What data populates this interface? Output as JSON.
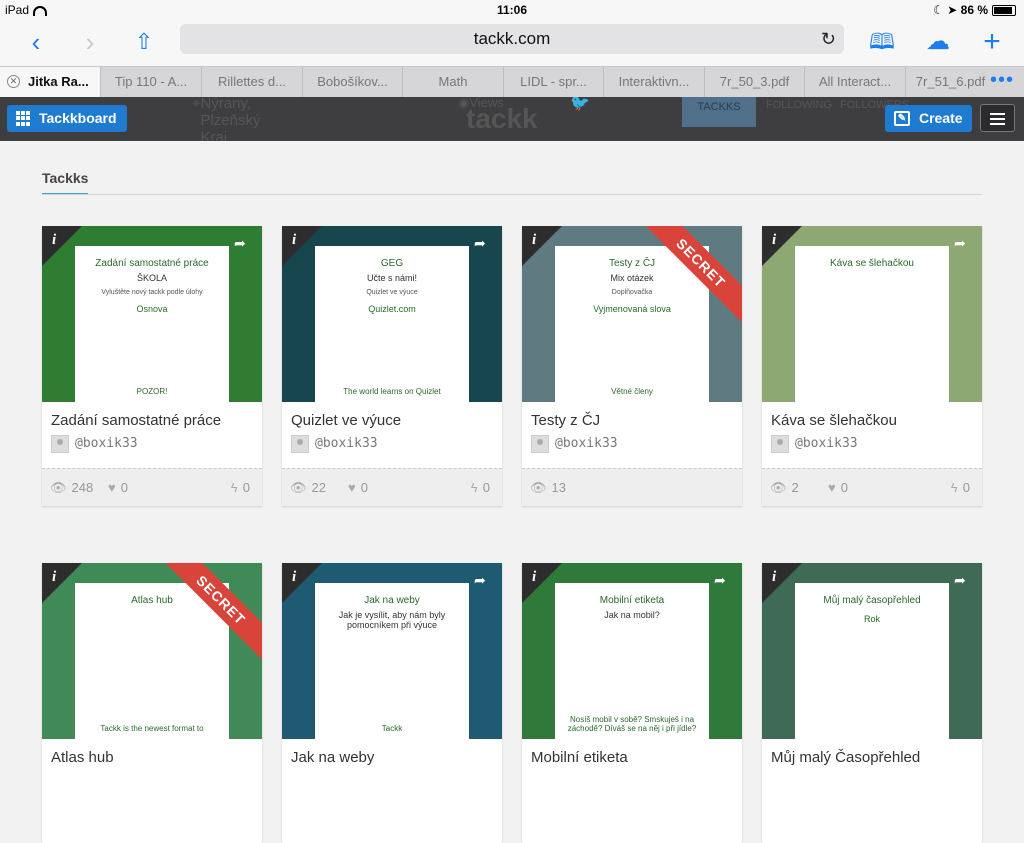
{
  "status": {
    "device": "iPad",
    "time": "11:06",
    "battery": "86 %"
  },
  "toolbar": {
    "url": "tackk.com"
  },
  "tabs": [
    {
      "label": "Jitka Ra..."
    },
    {
      "label": "Tip 110 - A..."
    },
    {
      "label": "Rillettes d..."
    },
    {
      "label": "Bobošíkov..."
    },
    {
      "label": "Math"
    },
    {
      "label": "LIDL - spr..."
    },
    {
      "label": "Interaktivn..."
    },
    {
      "label": "7r_50_3.pdf"
    },
    {
      "label": "All Interact..."
    },
    {
      "label": "7r_51_6.pdf"
    }
  ],
  "header": {
    "board_label": "Tackkboard",
    "create_label": "Create",
    "behind_location": "Nýrany, Plzeňský Kraj, Czech Republic",
    "behind_views": "Views",
    "behind_logo": "tackk",
    "behind_tackks": "TACKKS",
    "behind_following": "FOLLOWING",
    "behind_followers": "FOLLOWERS"
  },
  "section": {
    "title": "Tackks"
  },
  "cards": [
    {
      "title": "Zadání samostatné práce",
      "author": "@boxik33",
      "views": "248",
      "likes": "0",
      "shares": "0",
      "secret": false,
      "bg": "#2e7d32",
      "thumb_title": "Zadání samostatné práce",
      "thumb_sub": "ŠKOLA",
      "thumb_text": "Vyluštěte nový tackk podle úlohy",
      "thumb_h2": "Osnova",
      "thumb_foot": "POZOR!"
    },
    {
      "title": "Quizlet ve výuce",
      "author": "@boxik33",
      "views": "22",
      "likes": "0",
      "shares": "0",
      "secret": false,
      "bg": "#17464f",
      "thumb_title": "GEG",
      "thumb_sub": "Učte s námi!",
      "thumb_text": "Quizlet ve výuce",
      "thumb_h2": "Quizlet.com",
      "thumb_foot": "The world learns on Quizlet"
    },
    {
      "title": "Testy z ČJ",
      "author": "@boxik33",
      "views": "13",
      "likes": "",
      "shares": "",
      "secret": true,
      "secret_label": "SECRET",
      "bg": "#5f7a80",
      "thumb_title": "Testy z ČJ",
      "thumb_sub": "Mix otázek",
      "thumb_text": "Doplňovačka",
      "thumb_h2": "Vyjmenovaná slova",
      "thumb_foot": "Větné členy"
    },
    {
      "title": "Káva se šlehačkou",
      "author": "@boxik33",
      "views": "2",
      "likes": "0",
      "shares": "0",
      "secret": false,
      "bg": "#8ea873",
      "thumb_title": "Káva se šlehačkou",
      "thumb_sub": "",
      "thumb_text": "",
      "thumb_h2": "",
      "thumb_foot": ""
    },
    {
      "title": "Atlas hub",
      "author": "",
      "views": "",
      "likes": "",
      "shares": "",
      "secret": true,
      "secret_label": "SECRET",
      "bg": "#3f8a57",
      "thumb_title": "Atlas hub",
      "thumb_sub": "",
      "thumb_text": "",
      "thumb_h2": "",
      "thumb_foot": "Tackk is the newest format to"
    },
    {
      "title": "Jak na weby",
      "author": "",
      "views": "",
      "likes": "",
      "shares": "",
      "secret": false,
      "bg": "#1f5a73",
      "thumb_title": "Jak na weby",
      "thumb_sub": "Jak je vysílit, aby nám byly pomocníkem při výuce",
      "thumb_text": "",
      "thumb_h2": "",
      "thumb_foot": "Tackk"
    },
    {
      "title": "Mobilní etiketa",
      "author": "",
      "views": "",
      "likes": "",
      "shares": "",
      "secret": false,
      "bg": "#2f7a3a",
      "thumb_title": "Mobilní etiketa",
      "thumb_sub": "Jak na mobil?",
      "thumb_text": "",
      "thumb_h2": "",
      "thumb_foot": "Nosíš mobil v sobě? Smskuješ i na záchodě? Díváš se na něj i při jídle?"
    },
    {
      "title": "Můj malý Časopřehled",
      "author": "",
      "views": "",
      "likes": "",
      "shares": "",
      "secret": false,
      "bg": "#3f6b56",
      "thumb_title": "Můj malý časopřehled",
      "thumb_sub": "",
      "thumb_text": "",
      "thumb_h2": "Rok",
      "thumb_foot": ""
    }
  ]
}
